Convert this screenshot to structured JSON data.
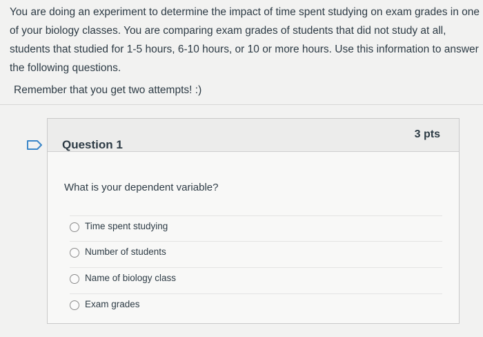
{
  "intro": {
    "paragraph": "You are doing an experiment to determine the impact of time spent studying on exam grades in one of your biology classes. You are comparing exam grades of students that did not study at all, students that studied for 1-5 hours, 6-10 hours, or 10 or more hours. Use this information to answer the following questions.",
    "reminder": "Remember that you get two attempts! :)"
  },
  "question": {
    "title": "Question 1",
    "points": "3 pts",
    "text": "What is your dependent variable?",
    "answers": [
      {
        "label": "Time spent studying"
      },
      {
        "label": "Number of students"
      },
      {
        "label": "Name of biology class"
      },
      {
        "label": "Exam grades"
      }
    ]
  },
  "icons": {
    "flag": "flag-icon"
  },
  "colors": {
    "text": "#2d3b45",
    "header_bg": "#ececeb",
    "flag": "#3a86c8"
  }
}
